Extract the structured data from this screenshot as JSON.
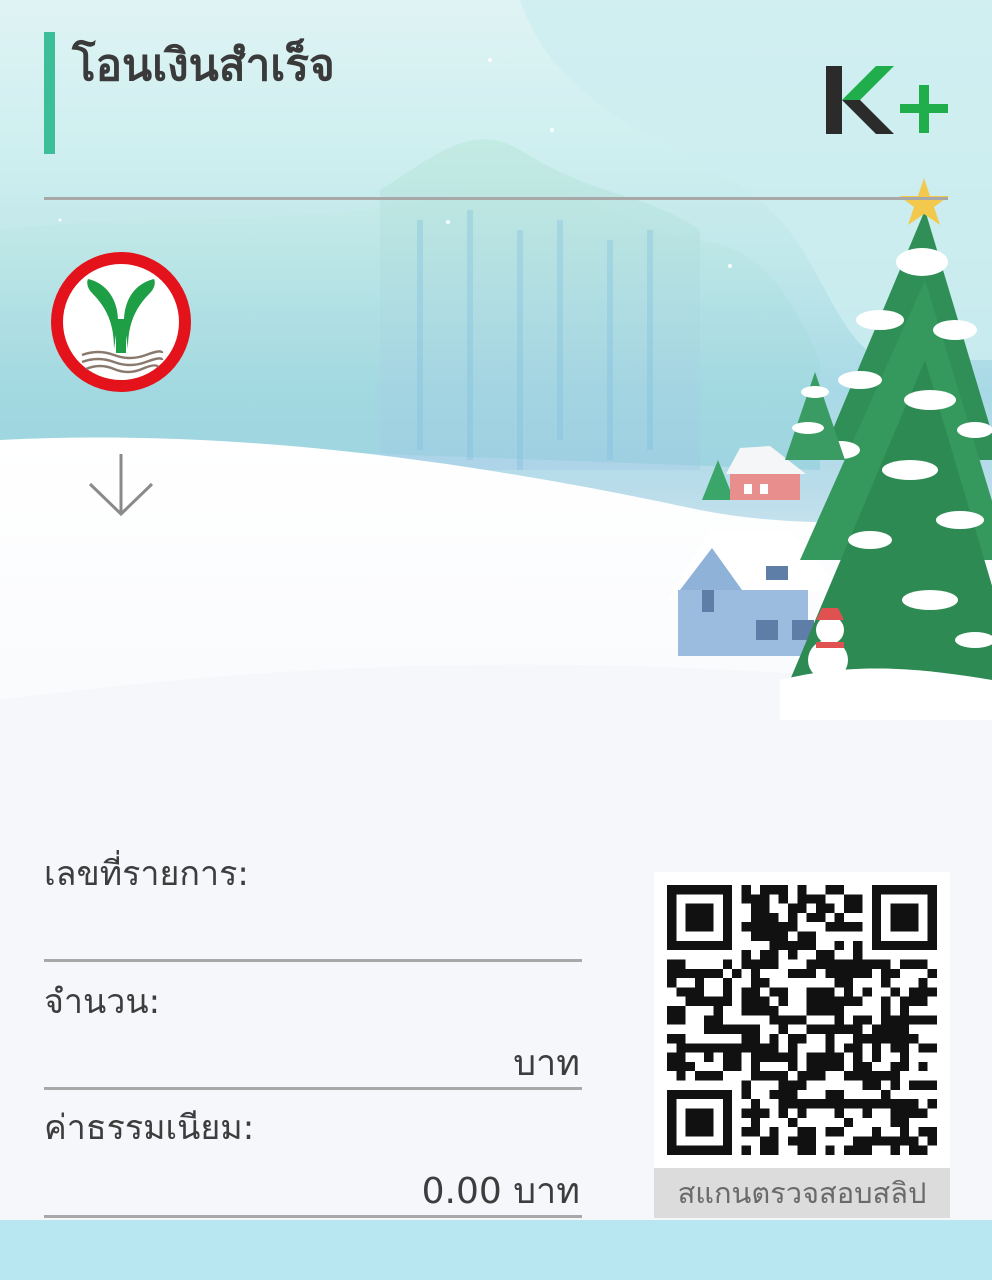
{
  "header": {
    "title": "โอนเงินสำเร็จ",
    "brand": "K+",
    "accent_color": "#3cbf98",
    "brand_green": "#1fae4b",
    "brand_dark": "#2b2b2b"
  },
  "sender": {
    "bank_logo": "kasikorn-bank-logo"
  },
  "transfer": {
    "direction_icon": "arrow-down-icon"
  },
  "details": {
    "reference_label": "เลขที่รายการ:",
    "amount_label": "จำนวน:",
    "amount_value": "บาท",
    "fee_label": "ค่าธรรมเนียม:",
    "fee_value": "0.00 บาท"
  },
  "qr": {
    "caption": "สแกนตรวจสอบสลิป",
    "icon": "qr-code"
  },
  "decoration": {
    "theme": "winter-christmas",
    "tree_star_color": "#f2c94c"
  }
}
